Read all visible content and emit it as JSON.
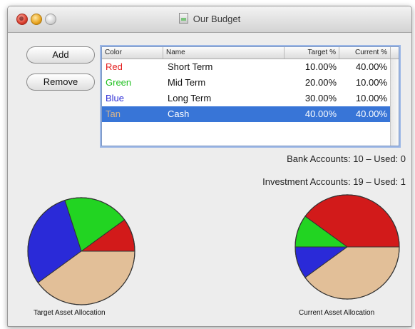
{
  "window": {
    "title": "Our Budget"
  },
  "buttons": {
    "add_label": "Add",
    "remove_label": "Remove"
  },
  "table": {
    "columns": [
      "Color",
      "Name",
      "Target %",
      "Current %"
    ],
    "rows": [
      {
        "color": "Red",
        "name": "Short Term",
        "target": "10.00%",
        "current": "40.00%"
      },
      {
        "color": "Green",
        "name": "Mid Term",
        "target": "20.00%",
        "current": "10.00%"
      },
      {
        "color": "Blue",
        "name": "Long Term",
        "target": "30.00%",
        "current": "10.00%"
      },
      {
        "color": "Tan",
        "name": "Cash",
        "target": "40.00%",
        "current": "40.00%"
      }
    ],
    "selected_row": 3
  },
  "info": {
    "bank_accounts": "Bank Accounts: 10 – Used: 0",
    "investment_accounts": "Investment Accounts: 19 – Used: 1"
  },
  "colors": {
    "red": "#d21a1a",
    "green": "#22d422",
    "blue": "#2a2ad8",
    "tan": "#e2bf98",
    "selection": "#3875d7",
    "text_red": "#e31b1b",
    "text_green": "#1fbf1f",
    "text_blue": "#2d2dd6",
    "text_tan": "#d8b58c"
  },
  "chart_data": [
    {
      "type": "pie",
      "caption": "Target Asset Allocation",
      "categories": [
        "Red",
        "Green",
        "Blue",
        "Tan"
      ],
      "values": [
        10,
        20,
        30,
        40
      ]
    },
    {
      "type": "pie",
      "caption": "Current Asset Allocation",
      "categories": [
        "Red",
        "Green",
        "Blue",
        "Tan"
      ],
      "values": [
        40,
        10,
        10,
        40
      ]
    }
  ]
}
